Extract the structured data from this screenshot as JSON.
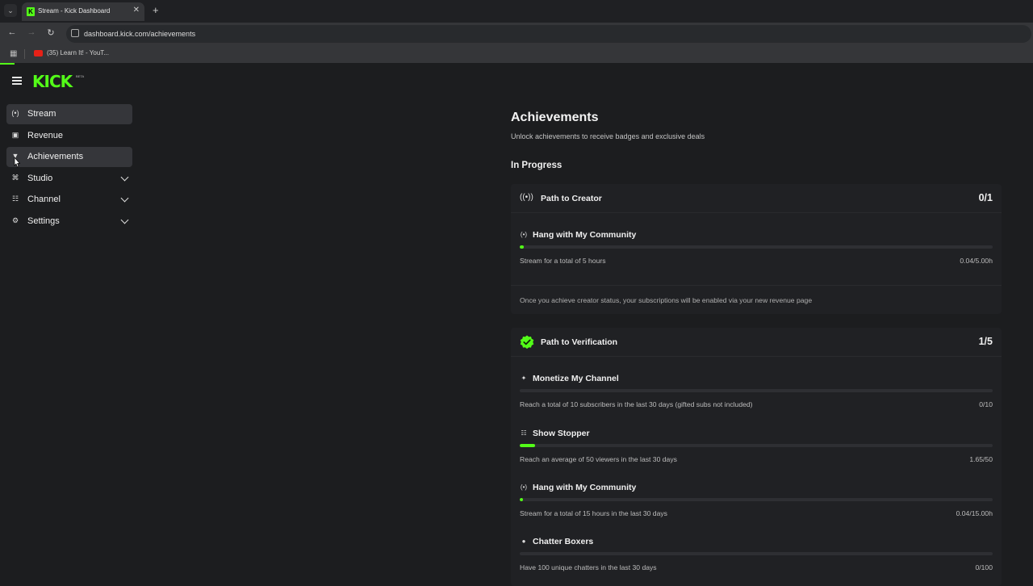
{
  "browser": {
    "tab_title": "Stream - Kick Dashboard",
    "url": "dashboard.kick.com/achievements",
    "bookmark_label": "(35) Learn It! - YouT..."
  },
  "app": {
    "logo": "KICK",
    "logo_badge": "BETA",
    "accent": "#53fc18"
  },
  "sidebar": {
    "items": [
      {
        "label": "Stream",
        "icon": "broadcast-icon",
        "active": true,
        "expandable": false
      },
      {
        "label": "Revenue",
        "icon": "revenue-icon",
        "active": false,
        "expandable": false
      },
      {
        "label": "Achievements",
        "icon": "badge-icon",
        "active": true,
        "expandable": false
      },
      {
        "label": "Studio",
        "icon": "studio-icon",
        "active": false,
        "expandable": true
      },
      {
        "label": "Channel",
        "icon": "users-icon",
        "active": false,
        "expandable": true
      },
      {
        "label": "Settings",
        "icon": "gear-icon",
        "active": false,
        "expandable": true
      }
    ]
  },
  "main": {
    "title": "Achievements",
    "subtitle": "Unlock achievements to receive badges and exclusive deals",
    "section_title": "In Progress",
    "cards": [
      {
        "title": "Path to Creator",
        "count": "0/1",
        "achievements": [
          {
            "title": "Hang with My Community",
            "description": "Stream for a total of 5 hours",
            "value": "0.04/5.00h",
            "progress": 0.008
          }
        ],
        "note": "Once you achieve creator status, your subscriptions will be enabled via your new revenue page"
      },
      {
        "title": "Path to Verification",
        "count": "1/5",
        "achievements": [
          {
            "title": "Monetize My Channel",
            "description": "Reach a total of 10 subscribers in the last 30 days (gifted subs not included)",
            "value": "0/10",
            "progress": 0
          },
          {
            "title": "Show Stopper",
            "description": "Reach an average of 50 viewers in the last 30 days",
            "value": "1.65/50",
            "progress": 0.033
          },
          {
            "title": "Hang with My Community",
            "description": "Stream for a total of 15 hours in the last 30 days",
            "value": "0.04/15.00h",
            "progress": 0.003
          },
          {
            "title": "Chatter Boxers",
            "description": "Have 100 unique chatters in the last 30 days",
            "value": "0/100",
            "progress": 0
          }
        ]
      }
    ]
  }
}
